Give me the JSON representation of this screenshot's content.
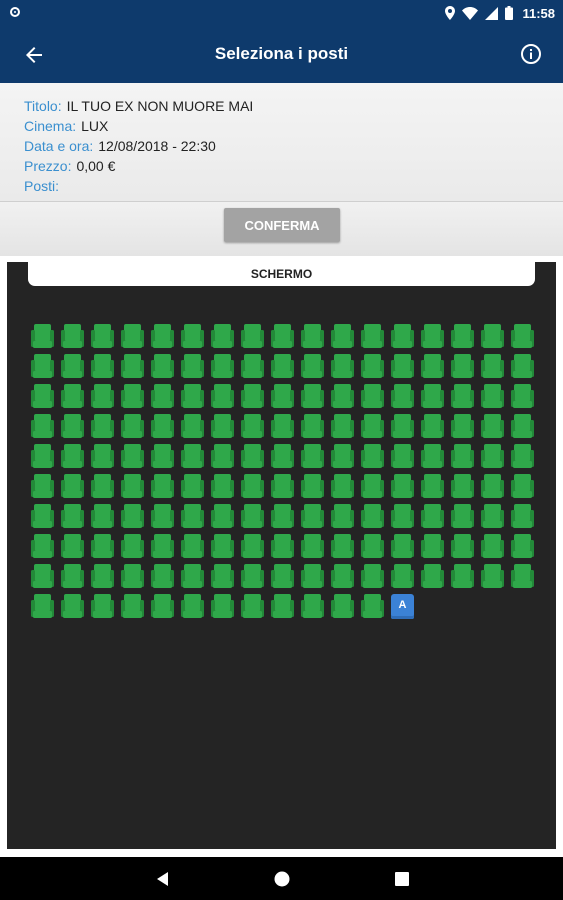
{
  "status_bar": {
    "time": "11:58",
    "icons": [
      "notification-ring-icon",
      "location-icon",
      "wifi-icon",
      "signal-icon",
      "battery-icon"
    ]
  },
  "app_bar": {
    "title": "Seleziona i posti",
    "back_icon": "arrow-left-icon",
    "info_icon": "info-icon"
  },
  "info": {
    "title_label": "Titolo:",
    "title_value": "IL TUO EX NON MUORE MAI",
    "cinema_label": "Cinema:",
    "cinema_value": "LUX",
    "datetime_label": "Data e ora:",
    "datetime_value": "12/08/2018 - 22:30",
    "price_label": "Prezzo:",
    "price_value": "0,00 €",
    "seats_label": "Posti:",
    "seats_value": ""
  },
  "confirm_label": "CONFERMA",
  "screen_label": "SCHERMO",
  "seat_map": {
    "columns": 17,
    "full_rows": 9,
    "last_row_seats": 12,
    "special_seat_label": "A",
    "available_color": "#2fa84a",
    "special_color": "#3b82d6"
  },
  "nav_bar": {
    "icons": [
      "back-triangle-icon",
      "home-circle-icon",
      "recents-square-icon"
    ]
  }
}
